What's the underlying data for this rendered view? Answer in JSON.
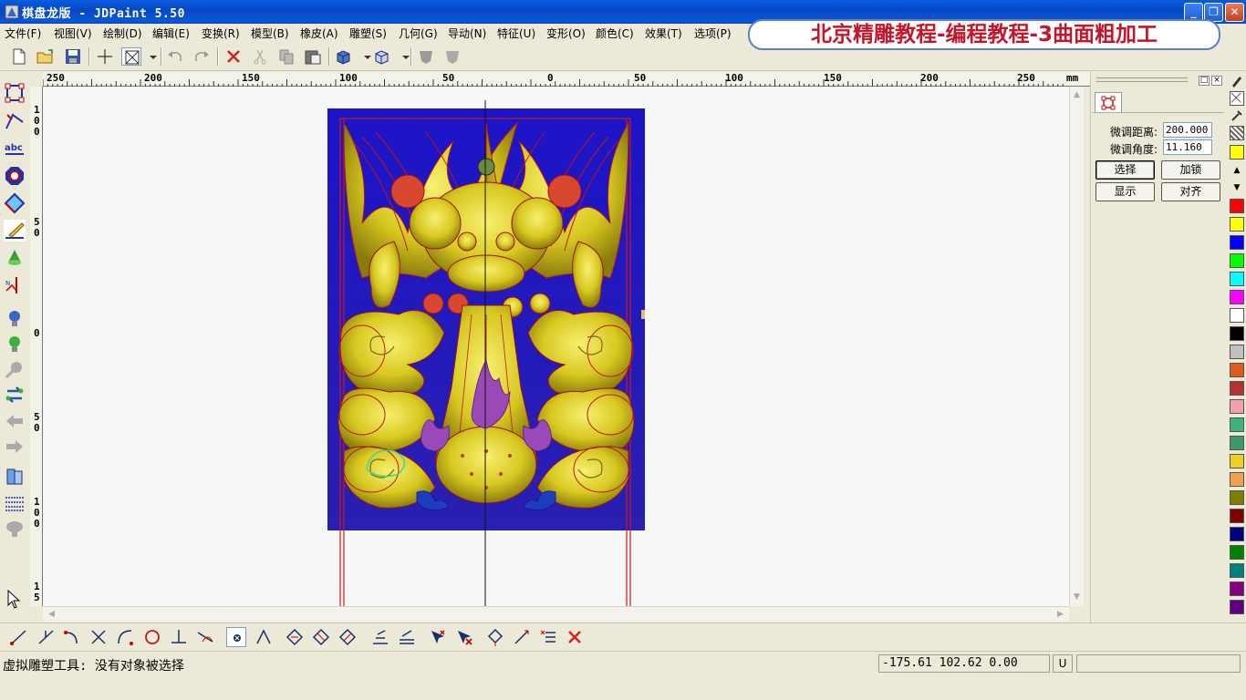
{
  "window": {
    "title": "棋盘龙版 - JDPaint 5.50",
    "buttons": {
      "minimize": "_",
      "maximize": "❐",
      "close": "✕"
    }
  },
  "overlay_banner": "北京精雕教程-编程教程-3曲面粗加工",
  "menu": [
    "文件(F)",
    "视图(V)",
    "绘制(D)",
    "编辑(E)",
    "变换(R)",
    "模型(B)",
    "橡皮(A)",
    "雕塑(S)",
    "几何(G)",
    "导动(N)",
    "特征(U)",
    "变形(O)",
    "颜色(C)",
    "效果(T)",
    "选项(P)"
  ],
  "ruler": {
    "unit": "mm",
    "h_labels": [
      "250",
      "200",
      "150",
      "100",
      "50",
      "0",
      "50",
      "100",
      "150",
      "200",
      "250"
    ],
    "v_labels": [
      "1\n0\n0",
      "5\n0",
      "0",
      "5\n0",
      "1\n0\n0",
      "1\n5"
    ]
  },
  "panel": {
    "distance_label": "微调距离:",
    "distance_value": "200.000",
    "angle_label": "微调角度:",
    "angle_value": "11.160",
    "buttons": {
      "select": "选择",
      "lock": "加锁",
      "show": "显示",
      "align": "对齐"
    }
  },
  "palette_colors": [
    "#ffff00",
    "#ff0000",
    "#ffff00",
    "#0000ff",
    "#00ff00",
    "#00ffff",
    "#ff00ff",
    "#ffffff",
    "#000000",
    "#c0c0c0",
    "#e05a1e",
    "#b83030",
    "#f0a0b0",
    "#40b080",
    "#3a9a6a",
    "#f0d020",
    "#f0a050",
    "#808000",
    "#800000",
    "#000080",
    "#008000",
    "#008080",
    "#800080",
    "#600080"
  ],
  "status": {
    "message": "虚拟雕塑工具: 没有对象被选择",
    "coordinates": "-175.61 102.62 0.00",
    "u_indicator": "U"
  }
}
